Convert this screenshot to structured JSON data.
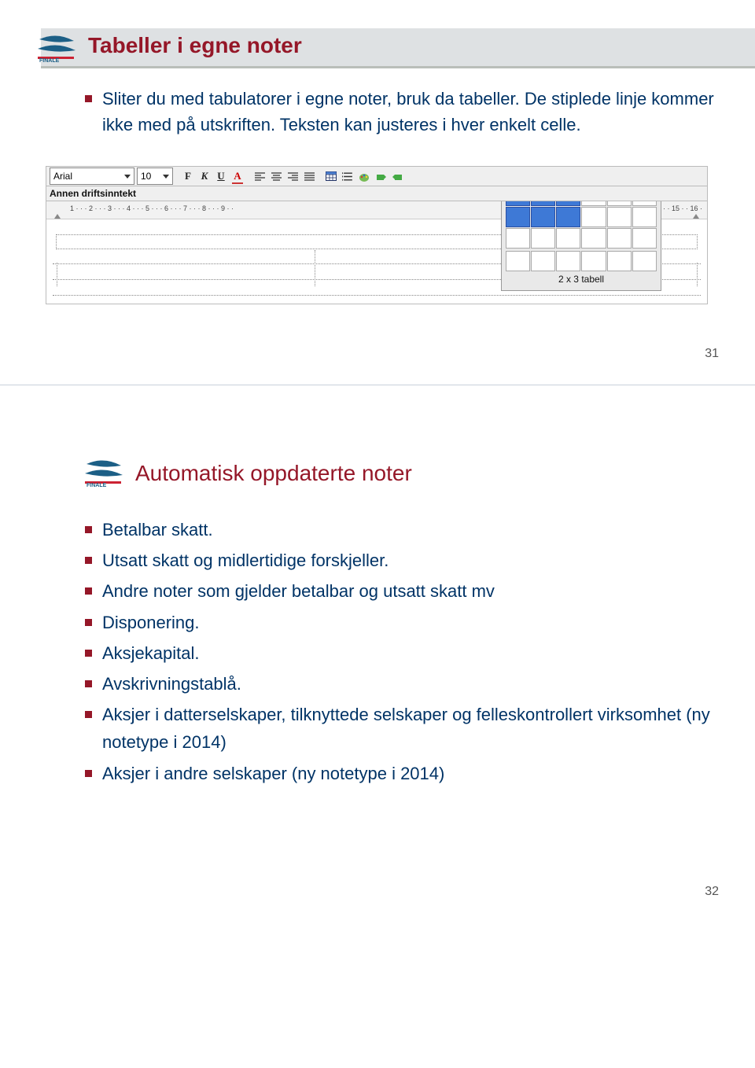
{
  "slide1": {
    "title": "Tabeller i egne noter",
    "bullets": [
      "Sliter du med tabulatorer i egne noter, bruk da tabeller. De stiplede linje kommer ikke med på utskriften. Teksten kan justeres i hver enkelt celle."
    ],
    "toolbar": {
      "font_name": "Arial",
      "font_size": "10",
      "subtitle": "Annen driftsinntekt",
      "table_label": "2 x 3 tabell"
    },
    "ruler": {
      "left_marks": "1 · · · 2 · · · 3 · · · 4 · · · 5 · · · 6 · · · 7 · · · 8 · · · 9 · ·",
      "right_marks": "· · 15 · · 16 ·"
    },
    "page_num": "31"
  },
  "slide2": {
    "title": "Automatisk oppdaterte noter",
    "bullets": [
      "Betalbar skatt.",
      "Utsatt skatt og midlertidige forskjeller.",
      "Andre noter som gjelder betalbar og utsatt skatt mv",
      "Disponering.",
      "Aksjekapital.",
      "Avskrivningstablå.",
      "Aksjer i datterselskaper, tilknyttede selskaper og felleskontrollert virksomhet (ny notetype i 2014)",
      "Aksjer i andre selskaper (ny notetype i 2014)"
    ],
    "page_num": "32"
  },
  "logo_brand": "FINALE"
}
